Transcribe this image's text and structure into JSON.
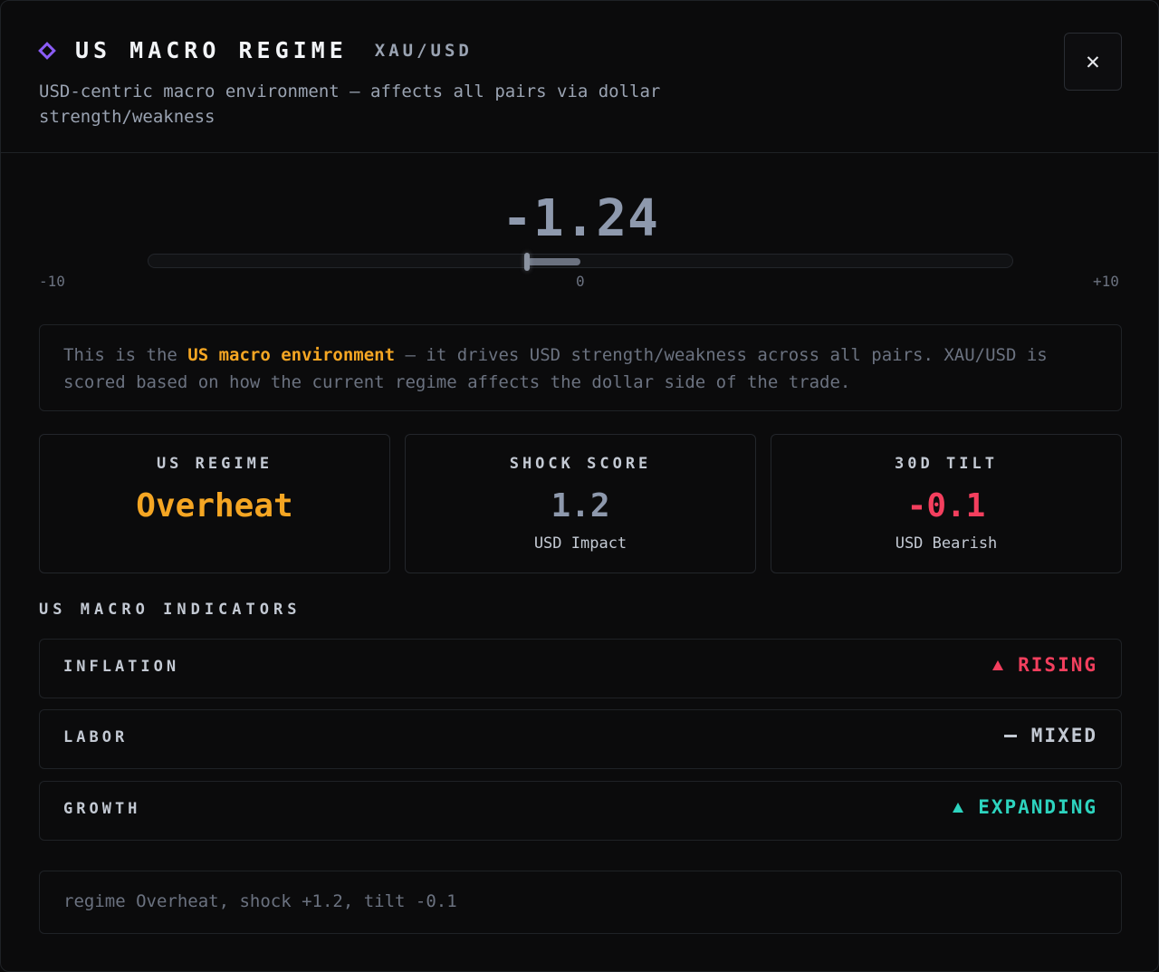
{
  "header": {
    "title": "US MACRO REGIME",
    "pair": "XAU/USD",
    "subtitle": "USD-centric macro environment — affects all pairs via dollar strength/weakness",
    "close_label": "✕",
    "icon": "diamond-icon",
    "accent_color": "#8b5cf6"
  },
  "score": {
    "display": "-1.24",
    "value": -1.24,
    "min": -10,
    "max": 10,
    "min_label": "-10",
    "zero_label": "0",
    "max_label": "+10"
  },
  "info": {
    "prefix": "This is the ",
    "highlight": "US macro environment",
    "suffix": " — it drives USD strength/weakness across all pairs. XAU/USD is scored based on how the current regime affects the dollar side of the trade."
  },
  "cards": [
    {
      "label": "US REGIME",
      "value": "Overheat",
      "sub": "",
      "color": "#f5a623"
    },
    {
      "label": "SHOCK SCORE",
      "value": "1.2",
      "sub": "USD Impact",
      "color": "#8e99ad"
    },
    {
      "label": "30D TILT",
      "value": "-0.1",
      "sub": "USD Bearish",
      "color": "#f43f5e"
    }
  ],
  "indicators": {
    "title": "US MACRO INDICATORS",
    "items": [
      {
        "name": "INFLATION",
        "status": "RISING",
        "icon": "triangle-up-icon",
        "color": "#f43f5e"
      },
      {
        "name": "LABOR",
        "status": "MIXED",
        "icon": "dash-icon",
        "color": "#c3c9d3"
      },
      {
        "name": "GROWTH",
        "status": "EXPANDING",
        "icon": "triangle-up-icon",
        "color": "#2dd4bf"
      }
    ]
  },
  "footer": {
    "text": "regime Overheat, shock +1.2, tilt -0.1"
  }
}
